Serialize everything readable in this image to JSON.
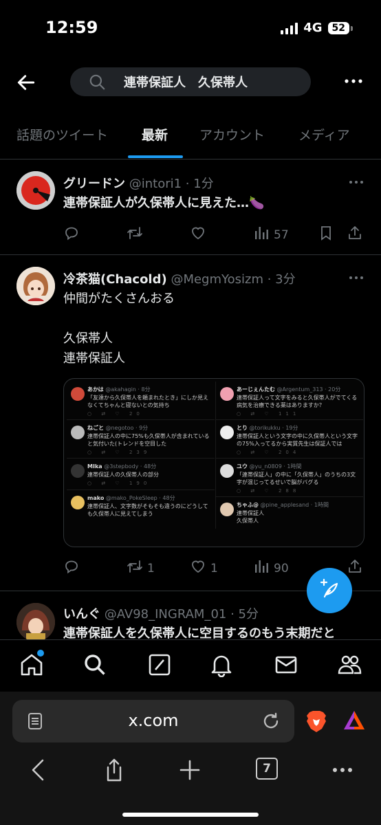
{
  "status_bar": {
    "time": "12:59",
    "network": "4G",
    "battery": "52"
  },
  "header": {
    "search_query": "連帯保証人　久保帯人"
  },
  "tabs": [
    {
      "label": "話題のツイート"
    },
    {
      "label": "最新"
    },
    {
      "label": "アカウント"
    },
    {
      "label": "メディア"
    }
  ],
  "tweets": [
    {
      "name": "グリードン",
      "handle": "@intori1 · 1分",
      "text": "連帯保証人が久保帯人に見えた…🍆",
      "retweets": "",
      "likes": "",
      "views": "57"
    },
    {
      "name": "冷茶猫(Chacold)",
      "handle": "@MegmYosizm · 3分",
      "text": "仲間がたくさんおる\n\n久保帯人\n連帯保証人",
      "retweets": "1",
      "likes": "1",
      "views": "90"
    },
    {
      "name": "いんぐ",
      "handle": "@AV98_INGRAM_01 · 5分",
      "text": "連帯保証人を久保帯人に空目するのもう末期だと"
    }
  ],
  "media_card": {
    "left": [
      {
        "name": "あかは",
        "handle": "@akahagin · 8分",
        "text": "「友達から久保帯人を頼まれたとき」にしか見えなくてちゃんと寝ないとの気持ち",
        "stats": "20"
      },
      {
        "name": "ねごと",
        "handle": "@negotoo · 9分",
        "text": "連帯保証人の中に75%も久保帯人が含まれていると気付いた(トレンドを空目した",
        "stats": "239"
      },
      {
        "name": "MIka",
        "handle": "@3stepbody · 48分",
        "text": "連帯保証人の久保帯人の部分",
        "stats": "190"
      },
      {
        "name": "mako",
        "handle": "@mako_PokeSleep · 48分",
        "text": "連帯保証人、文字数がそもそも違うのにどうしても久保帯人に見えてしまう",
        "stats": ""
      }
    ],
    "right": [
      {
        "name": "あーじぇんたむ",
        "handle": "@Argentum_313 · 20分",
        "text": "連帯保証人って文字をみると久保帯人がでてくる病気を治療できる薬はありますか？",
        "stats": "111"
      },
      {
        "name": "とり",
        "handle": "@torikukku · 19分",
        "text": "連帯保証人という文字の中に久保帯人という文字の75%入ってるから実質先生は保証人では",
        "stats": "204"
      },
      {
        "name": "ユウ",
        "handle": "@yu_n0809 · 1時間",
        "text": "「連帯保証人」の中に「久保帯人」のうちの3文字が混じってるせいで脳がバグる",
        "stats": "288"
      },
      {
        "name": "ちゃふ@",
        "handle": "@pine_applesand · 1時間",
        "text": "連帯保証人\n久保帯人",
        "stats": ""
      }
    ]
  },
  "browser": {
    "url": "x.com",
    "tab_count": "7"
  },
  "icons": {
    "back": "back-arrow-icon",
    "search": "search-icon",
    "more": "more-dots-icon",
    "reply": "reply-icon",
    "retweet": "retweet-icon",
    "like": "heart-icon",
    "views": "views-icon",
    "bookmark": "bookmark-icon",
    "share": "share-icon",
    "compose": "compose-icon",
    "home": "home-icon",
    "grok": "grok-icon",
    "notifications": "bell-icon",
    "messages": "envelope-icon",
    "communities": "communities-icon"
  },
  "colors": {
    "accent": "#1d9bf0",
    "background": "#000000",
    "muted": "#71767b",
    "text": "#e7e9ea"
  }
}
